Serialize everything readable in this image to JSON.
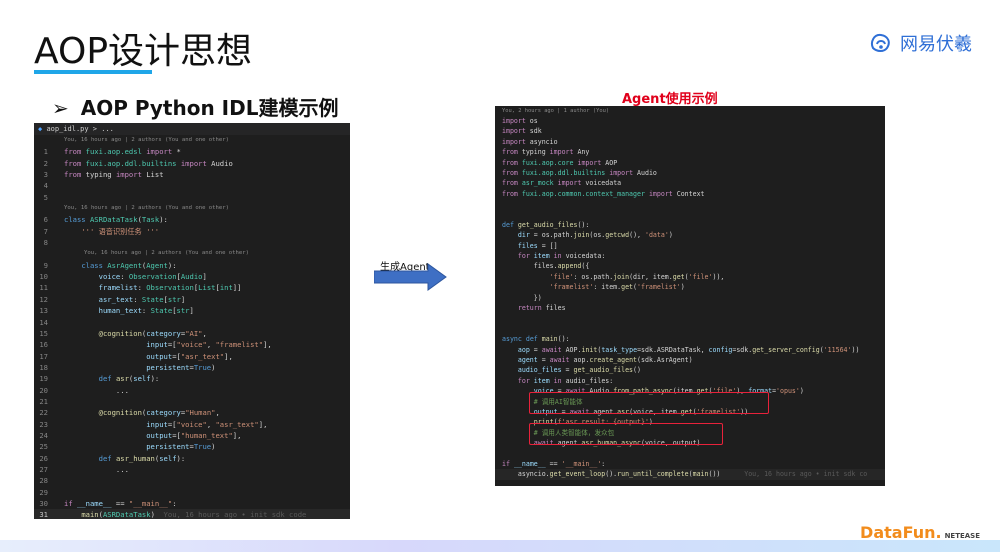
{
  "slide": {
    "title": "AOP设计思想",
    "subtitle": "AOP Python IDL建模示例",
    "subtitle_bullet": "➢",
    "logo_text": "网易伏羲",
    "right_title": "Agent使用示例",
    "arrow_label": "生成Agent",
    "footer_logo": "DataFun.",
    "footer_sub": "NETEASE"
  },
  "left_editor": {
    "tab": "aop_idl.py > ...",
    "blame1": "You, 16 hours ago | 2 authors (You and one other)",
    "blame2": "You, 16 hours ago | 2 authors (You and one other)",
    "blame3": "You, 16 hours ago | 2 authors (You and one other)",
    "inline_blame": "You, 16 hours ago • init sdk code",
    "lines": {
      "l1": "from fuxi.aop.edsl import *",
      "l2": "from fuxi.aop.ddl.builtins import Audio",
      "l3": "from typing import List",
      "l6": "class ASRDataTask(Task):",
      "l7": "    ''' 语音识别任务 '''",
      "l9": "    class AsrAgent(Agent):",
      "l10": "        voice: Observation[Audio]",
      "l11": "        framelist: Observation[List[int]]",
      "l12": "        asr_text: State[str]",
      "l13": "        human_text: State[str]",
      "l15": "        @cognition(category=\"AI\",",
      "l16": "                   input=[\"voice\", \"framelist\"],",
      "l17": "                   output=[\"asr_text\"],",
      "l18": "                   persistent=True)",
      "l19": "        def asr(self):",
      "l20": "            ...",
      "l22": "        @cognition(category=\"Human\",",
      "l23": "                   input=[\"voice\", \"asr_text\"],",
      "l24": "                   output=[\"human_text\"],",
      "l25": "                   persistent=True)",
      "l26": "        def asr_human(self):",
      "l27": "            ...",
      "l30": "if __name__ == \"__main__\":",
      "l31": "    main(ASRDataTask)"
    }
  },
  "right_editor": {
    "blame": "You, 2 hours ago | 1 author (You)",
    "inline_blame": "You, 16 hours ago • init sdk co",
    "lines": [
      "import os",
      "import sdk",
      "import asyncio",
      "from typing import Any",
      "from fuxi.aop.core import AOP",
      "from fuxi.aop.ddl.builtins import Audio",
      "from asr_mock import voicedata",
      "from fuxi.aop.common.context_manager import Context",
      "",
      "",
      "def get_audio_files():",
      "    dir = os.path.join(os.getcwd(), 'data')",
      "    files = []",
      "    for item in voicedata:",
      "        files.append({",
      "            'file': os.path.join(dir, item.get('file')),",
      "            'framelist': item.get('framelist')",
      "        })",
      "    return files",
      "",
      "",
      "async def main():",
      "    aop = await AOP.init(task_type=sdk.ASRDataTask, config=sdk.get_server_config('11564'))",
      "    agent = await aop.create_agent(sdk.AsrAgent)",
      "    audio_files = get_audio_files()",
      "    for item in audio_files:",
      "        voice = await Audio.from_path_async(item.get('file'), format='opus')",
      "        # 调用AI智能体",
      "        output = await agent.asr(voice, item.get('framelist'))",
      "        print(f'asr result: {output}')",
      "        # 调用人类智能体，发众包",
      "        await agent.asr_human_async(voice, output)",
      "",
      "if __name__ == '__main__':",
      "    asyncio.get_event_loop().run_until_complete(main())"
    ]
  }
}
